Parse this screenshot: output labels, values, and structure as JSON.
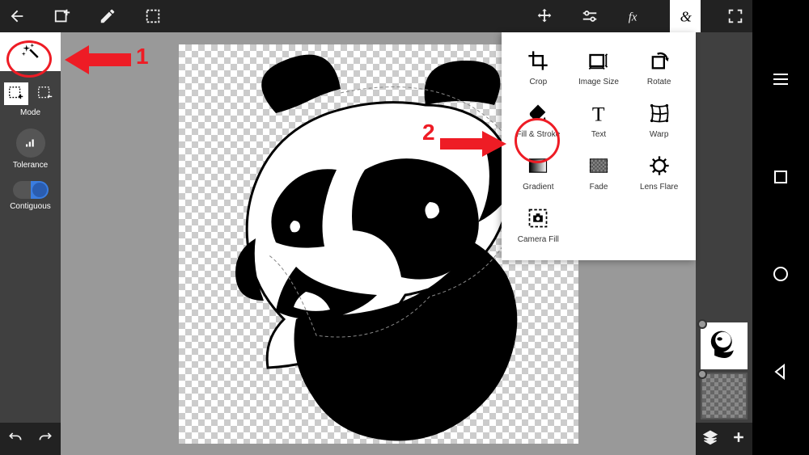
{
  "top_bar": {
    "back": "back",
    "add_image": "add-image",
    "edit": "edit",
    "crop_select": "crop-select",
    "move": "move",
    "adjust": "adjust",
    "fx": "fx",
    "ampersand": "&",
    "fullscreen": "fullscreen"
  },
  "sidebar": {
    "mode_label": "Mode",
    "tolerance_label": "Tolerance",
    "contiguous_label": "Contiguous"
  },
  "menu": {
    "items": [
      {
        "label": "Crop",
        "icon": "crop-icon"
      },
      {
        "label": "Image Size",
        "icon": "image-size-icon"
      },
      {
        "label": "Rotate",
        "icon": "rotate-icon"
      },
      {
        "label": "Fill & Stroke",
        "icon": "fill-stroke-icon"
      },
      {
        "label": "Text",
        "icon": "text-icon"
      },
      {
        "label": "Warp",
        "icon": "warp-icon"
      },
      {
        "label": "Gradient",
        "icon": "gradient-icon"
      },
      {
        "label": "Fade",
        "icon": "fade-icon"
      },
      {
        "label": "Lens Flare",
        "icon": "lens-flare-icon"
      },
      {
        "label": "Camera Fill",
        "icon": "camera-fill-icon"
      }
    ]
  },
  "annotations": {
    "one": "1",
    "two": "2"
  },
  "colors": {
    "bg": "#999999",
    "dark": "#222222",
    "panel": "#404040",
    "accent": "#ee1c25",
    "toggle_on": "#3a7de0"
  }
}
